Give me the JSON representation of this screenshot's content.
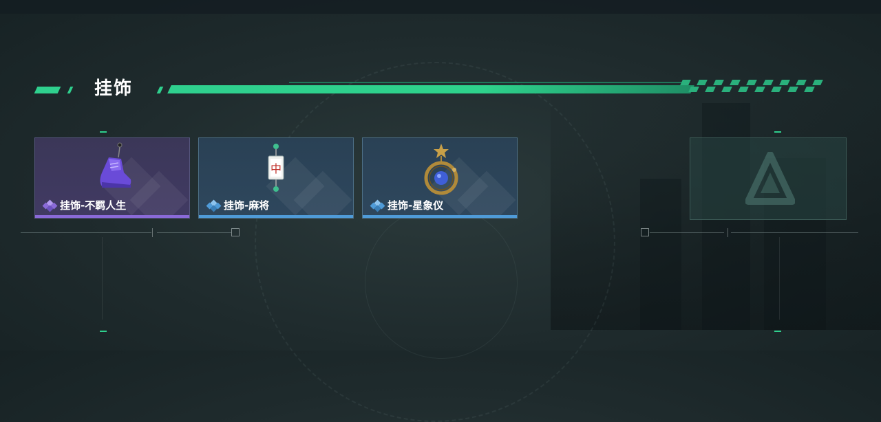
{
  "section": {
    "title": "挂饰"
  },
  "items": [
    {
      "label": "挂饰-不羁人生",
      "rarity": "purple",
      "rarity_color": "#8a6ad8",
      "icon": "sneaker-charm-icon"
    },
    {
      "label": "挂饰-麻将",
      "rarity": "blue",
      "rarity_color": "#4f9bd8",
      "icon": "mahjong-tile-charm-icon"
    },
    {
      "label": "挂饰-星象仪",
      "rarity": "blue",
      "rarity_color": "#4f9bd8",
      "icon": "astrolabe-charm-icon"
    }
  ],
  "empty_slot": {
    "icon": "logo-placeholder-icon"
  },
  "colors": {
    "accent": "#2fd08e",
    "purple": "#8a6ad8",
    "blue": "#4f9bd8"
  }
}
